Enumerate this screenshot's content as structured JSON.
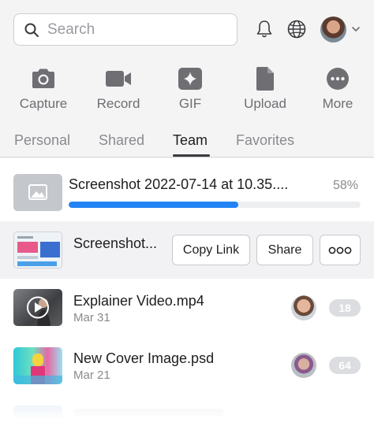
{
  "header": {
    "search_placeholder": "Search",
    "icons": [
      "bell-icon",
      "globe-icon",
      "avatar",
      "chevron-down-icon"
    ]
  },
  "actions": [
    {
      "label": "Capture",
      "icon": "camera-icon"
    },
    {
      "label": "Record",
      "icon": "video-camera-icon"
    },
    {
      "label": "GIF",
      "icon": "sparkle-icon"
    },
    {
      "label": "Upload",
      "icon": "file-icon"
    },
    {
      "label": "More",
      "icon": "more-circle-icon"
    }
  ],
  "tabs": [
    {
      "label": "Personal",
      "active": false
    },
    {
      "label": "Shared",
      "active": false
    },
    {
      "label": "Team",
      "active": true
    },
    {
      "label": "Favorites",
      "active": false
    }
  ],
  "uploading": {
    "title": "Screenshot 2022-07-14 at 10.35....",
    "percent_label": "58%",
    "progress": 0.58
  },
  "selected_item": {
    "title": "Screenshot...",
    "copy_link_label": "Copy Link",
    "share_label": "Share",
    "more_label": "ooo"
  },
  "items": [
    {
      "title": "Explainer Video.mp4",
      "date": "Mar 31",
      "count": "18"
    },
    {
      "title": "New Cover Image.psd",
      "date": "Mar 21",
      "count": "64"
    }
  ],
  "colors": {
    "accent": "#2383f5",
    "background": "#f4f4f5",
    "icon": "#6e6e73"
  }
}
